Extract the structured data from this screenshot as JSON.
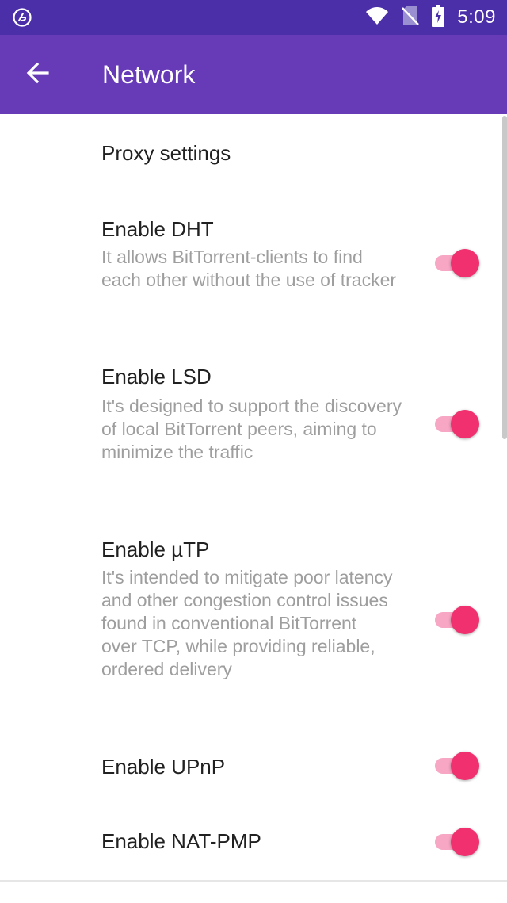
{
  "status_bar": {
    "time": "5:09",
    "icons": [
      "app-logo-icon",
      "wifi-icon",
      "no-sim-icon",
      "battery-charging-icon"
    ]
  },
  "app_bar": {
    "title": "Network",
    "back_icon": "arrow-back-icon"
  },
  "preferences": [
    {
      "title": "Proxy settings",
      "summary": ""
    },
    {
      "title": "Enable DHT",
      "summary": "It allows BitTorrent-clients to find each other without the use of tracker",
      "enabled": true
    },
    {
      "title": "Enable LSD",
      "summary": "It's designed to support the discovery of local BitTorrent peers, aiming to minimize the traffic",
      "enabled": true
    },
    {
      "title": "Enable µTP",
      "summary": "It's intended to mitigate poor latency and other congestion control issues found in conventional BitTorrent over TCP, while providing reliable, ordered delivery",
      "enabled": true
    },
    {
      "title": "Enable UPnP",
      "summary": "",
      "enabled": true
    },
    {
      "title": "Enable NAT-PMP",
      "summary": "",
      "enabled": true
    }
  ],
  "colors": {
    "status_bar": "#4b2fa8",
    "app_bar": "#673ab7",
    "accent": "#f0306f",
    "accent_track": "#f7a6c4"
  }
}
